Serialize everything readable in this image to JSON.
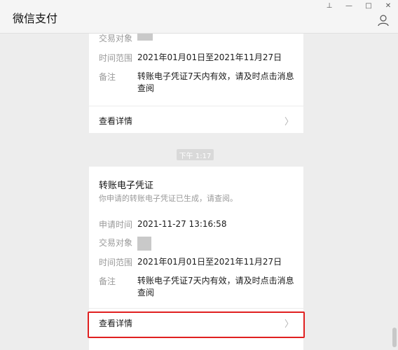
{
  "app": {
    "title": "微信支付"
  },
  "window_controls": {
    "pin": "⊥",
    "minimize": "—",
    "maximize": "□",
    "close": "✕"
  },
  "card1": {
    "rows": [
      {
        "label": "交易对象",
        "value": ""
      },
      {
        "label": "时间范围",
        "value": "2021年01月01日至2021年11月27日"
      },
      {
        "label": "备注",
        "value": "转账电子凭证7天内有效，请及时点击消息",
        "value2": "查阅"
      }
    ],
    "detail_label": "查看详情"
  },
  "timestamp": "下午 1:17",
  "card2": {
    "title": "转账电子凭证",
    "subtitle": "你申请的转账电子凭证已生成，请查阅。",
    "rows": [
      {
        "label": "申请时间",
        "value": "2021-11-27 13:16:58"
      },
      {
        "label": "交易对象",
        "value": ""
      },
      {
        "label": "时间范围",
        "value": "2021年01月01日至2021年11月27日"
      },
      {
        "label": "备注",
        "value": "转账电子凭证7天内有效，请及时点击消息",
        "value2": "查阅"
      }
    ],
    "detail_label": "查看详情"
  },
  "icons": {
    "user": "user-icon",
    "chevron": "chevron-right-icon"
  },
  "colors": {
    "highlight": "#e02020",
    "background": "#ededed"
  }
}
